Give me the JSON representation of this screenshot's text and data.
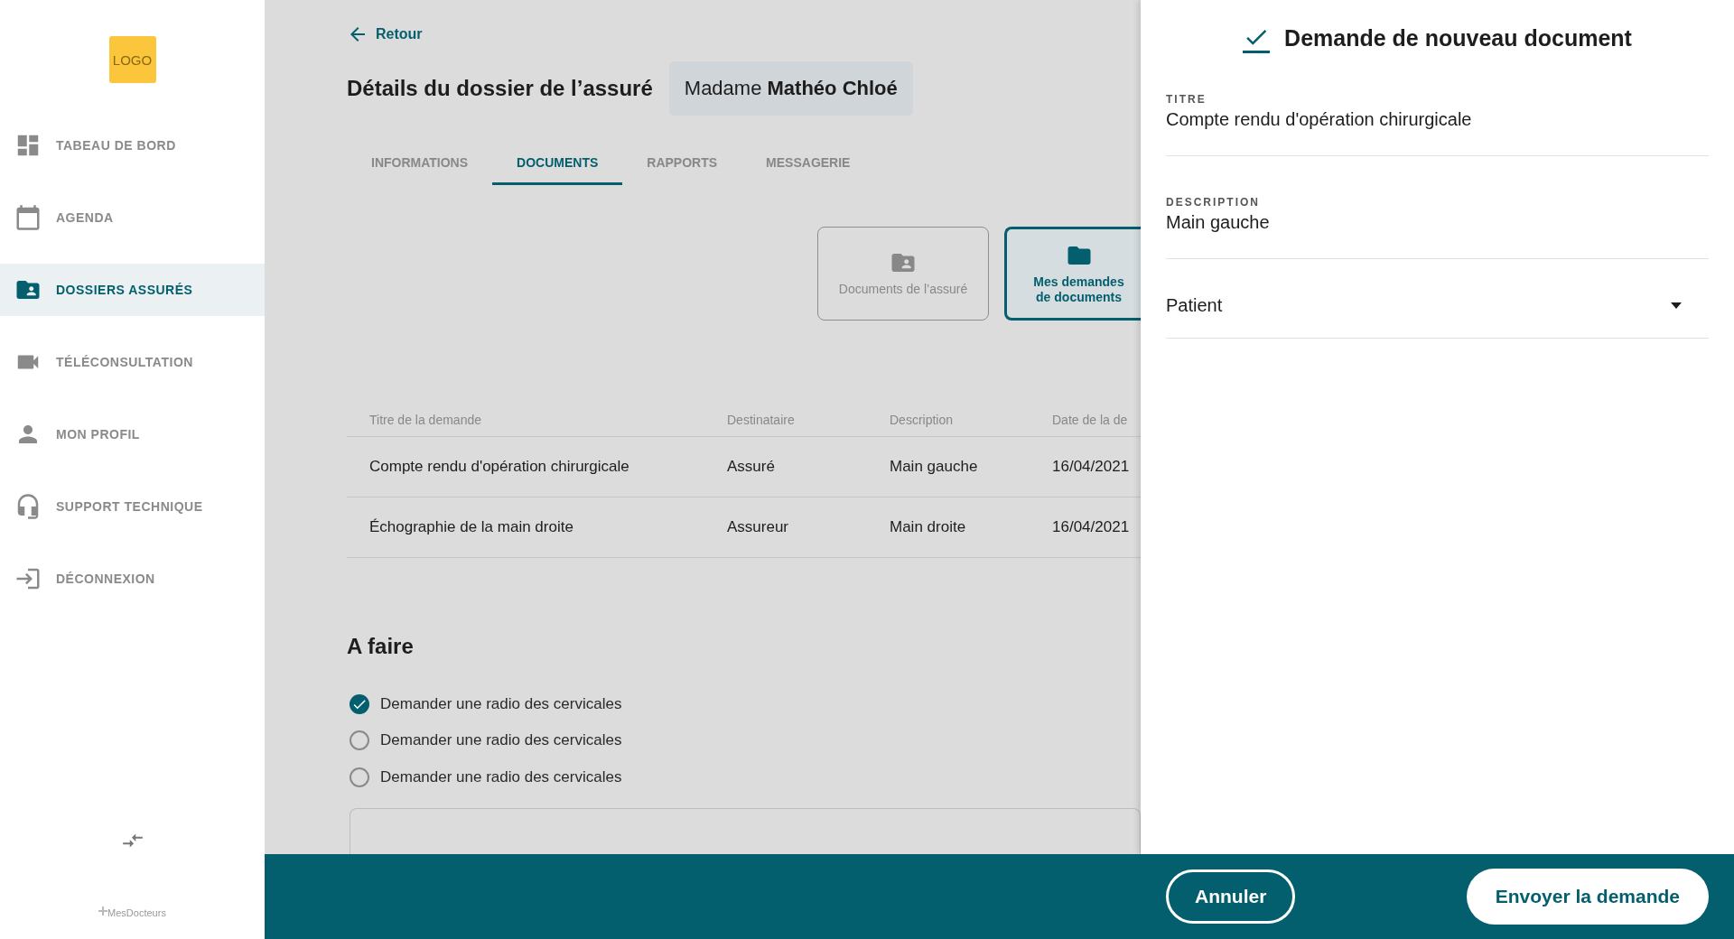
{
  "sidebar": {
    "logo": "LOGO",
    "items": [
      {
        "label": "TABEAU DE BORD",
        "selected": false
      },
      {
        "label": "AGENDA",
        "selected": false
      },
      {
        "label": "DOSSIERS ASSURÉS",
        "selected": true
      },
      {
        "label": "TÉLÉCONSULTATION",
        "selected": false
      },
      {
        "label": "MON PROFIL",
        "selected": false
      },
      {
        "label": "SUPPORT TECHNIQUE",
        "selected": false
      },
      {
        "label": "DÉCONNEXION",
        "selected": false
      }
    ],
    "brand": "MesDocteurs"
  },
  "main": {
    "back": "Retour",
    "title": "Détails du dossier de l’assuré",
    "patient": "Madame **Mathéo Chloé**",
    "tabs": [
      {
        "label": "INFORMATIONS",
        "selected": false
      },
      {
        "label": "DOCUMENTS",
        "selected": true
      },
      {
        "label": "RAPPORTS",
        "selected": false
      },
      {
        "label": "MESSAGERIE",
        "selected": false
      }
    ],
    "doc_cards": [
      {
        "lines": [
          "Documents de l’assuré"
        ],
        "selected": false
      },
      {
        "lines": [
          "Mes demandes",
          "de documents"
        ],
        "selected": true
      }
    ],
    "table": {
      "columns": [
        "Titre de la demande",
        "Destinataire",
        "Description",
        "Date de la de"
      ],
      "rows": [
        [
          "Compte rendu d'opération chirurgicale",
          "Assuré",
          "Main gauche",
          "16/04/2021"
        ],
        [
          "Échographie de la main droite",
          "Assureur",
          "Main droite",
          "16/04/2021"
        ]
      ]
    },
    "todo": {
      "title": "A faire",
      "items": [
        {
          "label": "Demander une radio des cervicales",
          "checked": true
        },
        {
          "label": "Demander une radio des cervicales",
          "checked": false
        },
        {
          "label": "Demander une radio des cervicales",
          "checked": false
        }
      ]
    }
  },
  "panel": {
    "title": "Demande de nouveau document",
    "fields": [
      {
        "kind": "text",
        "label": "TITRE",
        "value": "Compte rendu d'opération chirurgicale"
      },
      {
        "kind": "text",
        "label": "DESCRIPTION",
        "value": "Main gauche"
      },
      {
        "kind": "select",
        "value": "Patient"
      }
    ],
    "buttons": [
      {
        "label": "Annuler",
        "kind": "outline"
      },
      {
        "label": "Envoyer la demande",
        "kind": "filled"
      }
    ]
  }
}
